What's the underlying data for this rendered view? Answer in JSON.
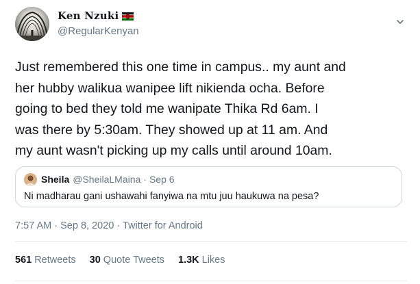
{
  "user": {
    "display_name": "Ken Nzuki",
    "handle": "@RegularKenyan",
    "avatar_icon": "profile-photo-archway",
    "flag_icon": "kenya-flag-icon"
  },
  "tweet": {
    "text": "Just remembered this one time in campus.. my aunt and\nher hubby walikua wanipee lift nikienda ocha. Before\ngoing to bed they told me wanipate Thika Rd 6am. I\nwas there by 5:30am. They showed up at 11 am. And\nmy aunt wasn't picking up my calls until around 10am."
  },
  "quoted_tweet": {
    "name": "Sheila",
    "handle": "@SheilaLMaina",
    "separator": "·",
    "date": "Sep 6",
    "text": "Ni madharau gani ushawahi fanyiwa na mtu juu haukuwa na pesa?"
  },
  "meta": {
    "time": "7:57 AM",
    "separator": "·",
    "date": "Sep 8, 2020",
    "source": "Twitter for Android"
  },
  "stats": {
    "retweets_count": "561",
    "retweets_label": "Retweets",
    "quotes_count": "30",
    "quotes_label": "Quote Tweets",
    "likes_count": "1.3K",
    "likes_label": "Likes"
  },
  "colors": {
    "text_primary": "#14171a",
    "text_secondary": "#657786",
    "border": "#ccd6dd"
  }
}
